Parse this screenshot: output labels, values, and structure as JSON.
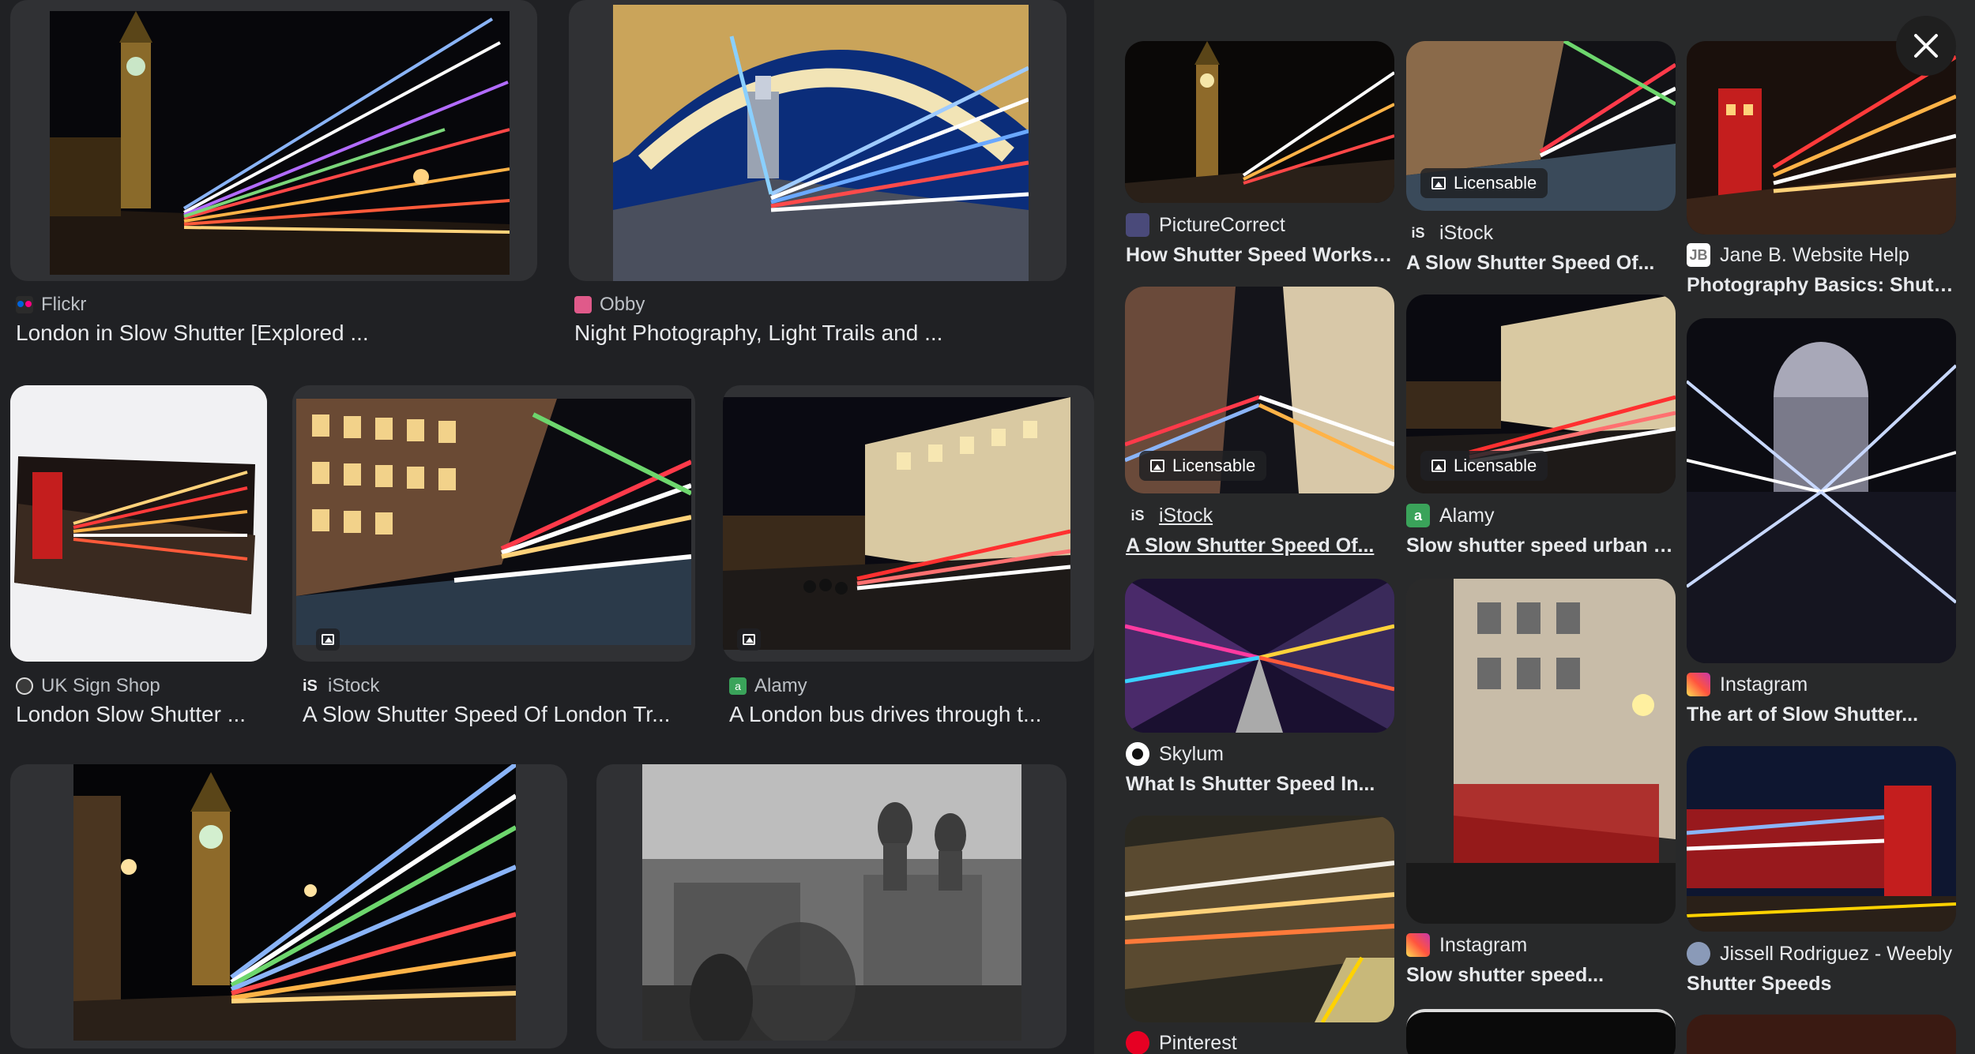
{
  "results": [
    {
      "source": "Flickr",
      "title": "London in Slow Shutter [Explored ...",
      "favicon": "flickr-favicon"
    },
    {
      "source": "Obby",
      "title": "Night Photography, Light Trails and ...",
      "favicon": "obby-favicon"
    },
    {
      "source": "UK Sign Shop",
      "title": "London Slow Shutter ...",
      "favicon": "uk-sign-shop-favicon"
    },
    {
      "source": "iStock",
      "title": "A Slow Shutter Speed Of London Tr...",
      "favicon": "istock-favicon"
    },
    {
      "source": "Alamy",
      "title": "A London bus drives through t...",
      "favicon": "alamy-favicon"
    }
  ],
  "related": [
    {
      "source": "PictureCorrect",
      "title": "How Shutter Speed Works:...",
      "badge": ""
    },
    {
      "source": "iStock",
      "title": "A Slow Shutter Speed Of...",
      "badge": "Licensable"
    },
    {
      "source": "Jane B. Website Help",
      "title": "Photography Basics: Shutte...",
      "badge": ""
    },
    {
      "source": "iStock",
      "title": "A Slow Shutter Speed Of...",
      "badge": "Licensable"
    },
    {
      "source": "Alamy",
      "title": "Slow shutter speed urban hi...",
      "badge": "Licensable"
    },
    {
      "source": "Instagram",
      "title": "The art of Slow Shutter...",
      "badge": ""
    },
    {
      "source": "Skylum",
      "title": "What Is Shutter Speed In...",
      "badge": ""
    },
    {
      "source": "Instagram",
      "title": "Slow shutter speed...",
      "badge": ""
    },
    {
      "source": "Jissell Rodriguez - Weebly",
      "title": "Shutter Speeds",
      "badge": ""
    },
    {
      "source": "Pinterest",
      "title": "",
      "badge": ""
    }
  ],
  "colors": {
    "accent": "#8ab4f8",
    "background": "#202124",
    "panel": "#28292a"
  }
}
